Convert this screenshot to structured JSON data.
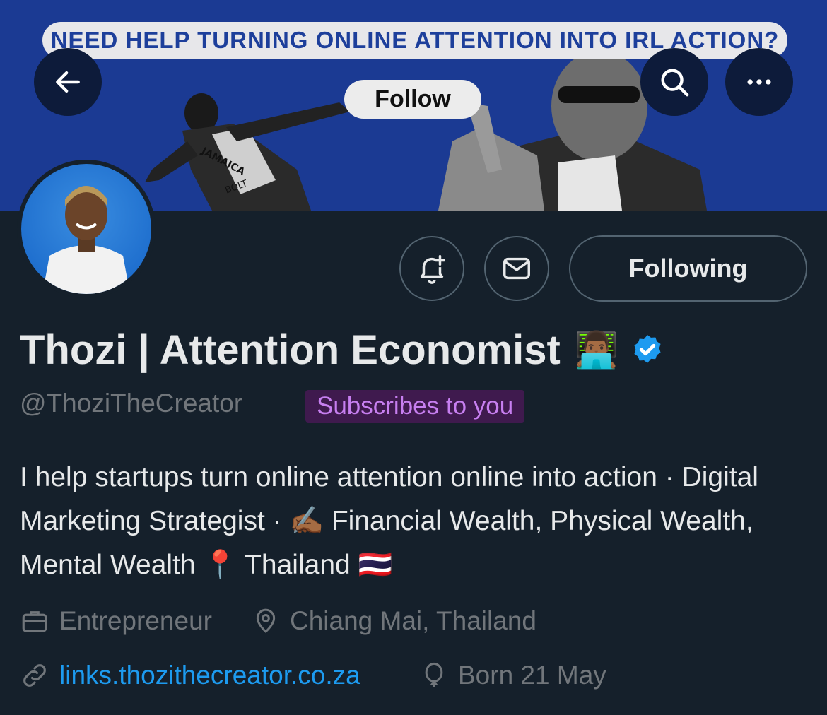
{
  "banner": {
    "headline": "NEED HELP TURNING ONLINE ATTENTION INTO IRL ACTION?",
    "follow_label": "Follow",
    "shirt_text": "JAMAICA",
    "bib_text": "BOLT"
  },
  "nav": {
    "back_icon": "arrow-left-icon",
    "search_icon": "search-icon",
    "more_icon": "more-icon"
  },
  "actions": {
    "notify_icon": "bell-plus-icon",
    "message_icon": "mail-icon",
    "following_label": "Following"
  },
  "profile": {
    "name": "Thozi | Attention Economist",
    "name_emoji": "👨🏾‍💻",
    "handle": "@ThoziTheCreator",
    "subscribes_badge": "Subscribes to you",
    "bio": "I help startups turn online attention online into action · Digital Marketing Strategist · ✍🏾 Financial Wealth, Physical Wealth, Mental Wealth 📍 Thailand 🇹🇭",
    "profession": "Entrepreneur",
    "location": "Chiang Mai, Thailand",
    "website": "links.thozithecreator.co.za",
    "birthday": "Born 21 May"
  },
  "colors": {
    "background": "#15202b",
    "banner": "#1b3a93",
    "accent": "#1d9bf0",
    "verified": "#1d9bf0",
    "subscribe_badge_bg": "#3f1a4e",
    "subscribe_badge_text": "#c77ff0"
  }
}
